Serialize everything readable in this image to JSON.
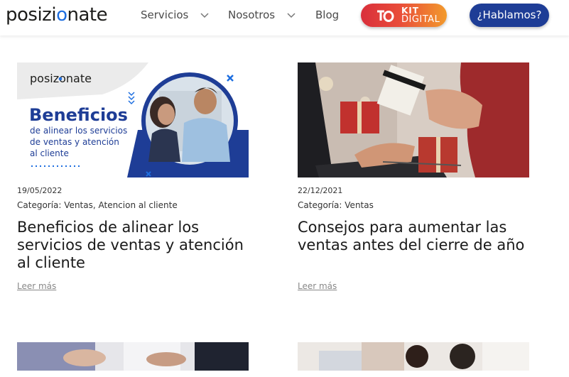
{
  "header": {
    "logo": {
      "pre": "posizi",
      "dot": "o",
      "post": "nate"
    },
    "nav": [
      {
        "label": "Servicios",
        "has_dropdown": true
      },
      {
        "label": "Nosotros",
        "has_dropdown": true
      },
      {
        "label": "Blog",
        "has_dropdown": false
      }
    ],
    "kit_digital": {
      "top": "KIT",
      "bottom": "DIGITAL"
    },
    "cta": "¿Hablamos?"
  },
  "posts": [
    {
      "image_texts": {
        "brand": "posizonate",
        "headline": "Beneficios",
        "line1": "de alinear los servicios",
        "line2": "de ventas y atención",
        "line3": "al cliente"
      },
      "date": "19/05/2022",
      "category_label": "Categoría:",
      "category_value": "Ventas, Atencion al cliente",
      "title": "Beneficios de alinear los servicios de ventas y atención al cliente",
      "more": "Leer más"
    },
    {
      "date": "22/12/2021",
      "category_label": "Categoría:",
      "category_value": "Ventas",
      "title": "Consejos para aumentar las ventas antes del cierre de año",
      "more": "Leer más"
    }
  ],
  "colors": {
    "brand_blue": "#1d6ee0",
    "navy": "#1e3d96",
    "kit_red": "#d92f3b",
    "kit_orange": "#f29a2c"
  }
}
